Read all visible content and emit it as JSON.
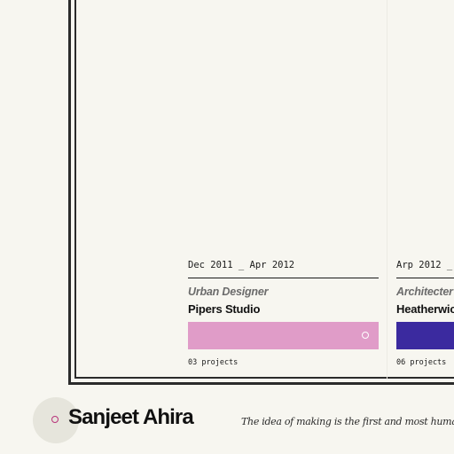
{
  "experience": [
    {
      "dates": "Dec 2011 _ Apr 2012",
      "role": "Urban Designer",
      "company": "Pipers Studio",
      "color": "#e09cc8",
      "projects": "03 projects"
    },
    {
      "dates": "Arp 2012 _",
      "role": "Architecter",
      "company": "Heatherwic",
      "color": "#3b2a9f",
      "projects": "06 projects"
    }
  ],
  "footer": {
    "name": "Sanjeet Ahira",
    "quote": "The idea of making is the first and most human of",
    "accent": "#b8337a"
  }
}
